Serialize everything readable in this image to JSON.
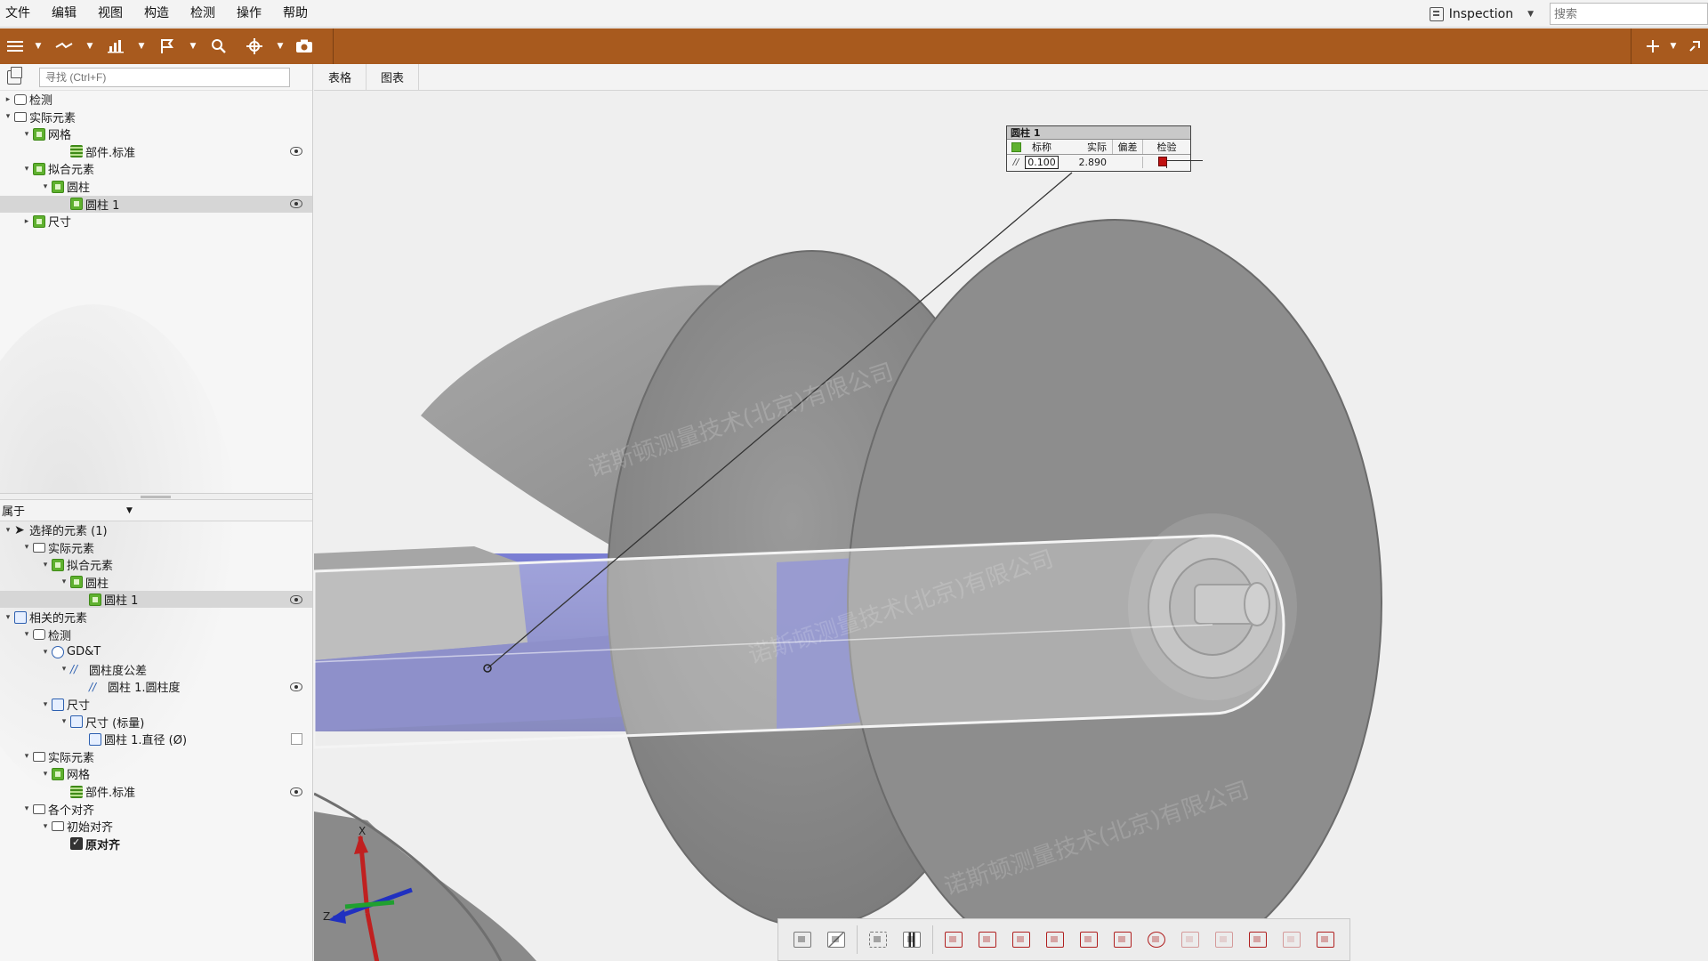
{
  "menu": [
    "文件",
    "编辑",
    "视图",
    "构造",
    "检测",
    "操作",
    "帮助"
  ],
  "workspace": {
    "name": "Inspection"
  },
  "search": {
    "placeholder": "搜索"
  },
  "find": {
    "placeholder": "寻找 (Ctrl+F)"
  },
  "tree_top": [
    {
      "label": "检测",
      "depth": 0,
      "twisty": "collapsed",
      "icon": "inspection-icon"
    },
    {
      "label": "实际元素",
      "depth": 0,
      "twisty": "expanded",
      "icon": "folder-icon"
    },
    {
      "label": "网格",
      "depth": 1,
      "twisty": "expanded",
      "icon": "mesh-icon"
    },
    {
      "label": "部件.标准",
      "depth": 3,
      "twisty": "none",
      "icon": "mesh-grid-icon",
      "eye": true
    },
    {
      "label": "拟合元素",
      "depth": 1,
      "twisty": "expanded",
      "icon": "fitted-elements-icon"
    },
    {
      "label": "圆柱",
      "depth": 2,
      "twisty": "expanded",
      "icon": "cylinder-group-icon"
    },
    {
      "label": "圆柱 1",
      "depth": 3,
      "twisty": "none",
      "icon": "cylinder-icon",
      "eye": true,
      "selected": true
    },
    {
      "label": "尺寸",
      "depth": 1,
      "twisty": "collapsed",
      "icon": "dimension-icon"
    }
  ],
  "properties": {
    "dropdown_label": "属于"
  },
  "tree_bottom": [
    {
      "label": "选择的元素 (1)",
      "depth": 0,
      "twisty": "expanded",
      "icon": "cursor-icon"
    },
    {
      "label": "实际元素",
      "depth": 1,
      "twisty": "expanded",
      "icon": "folder-icon"
    },
    {
      "label": "拟合元素",
      "depth": 2,
      "twisty": "expanded",
      "icon": "fitted-elements-icon"
    },
    {
      "label": "圆柱",
      "depth": 3,
      "twisty": "expanded",
      "icon": "cylinder-group-icon"
    },
    {
      "label": "圆柱 1",
      "depth": 4,
      "twisty": "none",
      "icon": "cylinder-icon",
      "eye": true,
      "selected": true
    },
    {
      "label": "相关的元素",
      "depth": 0,
      "twisty": "expanded",
      "icon": "related-icon"
    },
    {
      "label": "检测",
      "depth": 1,
      "twisty": "expanded",
      "icon": "inspection-icon"
    },
    {
      "label": "GD&T",
      "depth": 2,
      "twisty": "expanded",
      "icon": "gdt-target-icon"
    },
    {
      "label": "圆柱度公差",
      "depth": 3,
      "twisty": "expanded",
      "icon": "cylindricity-icon"
    },
    {
      "label": "圆柱 1.圆柱度",
      "depth": 4,
      "twisty": "none",
      "icon": "cylindricity-icon",
      "eye": true
    },
    {
      "label": "尺寸",
      "depth": 2,
      "twisty": "expanded",
      "icon": "dimension-blue-icon"
    },
    {
      "label": "尺寸 (标量)",
      "depth": 3,
      "twisty": "expanded",
      "icon": "dimension-scalar-icon"
    },
    {
      "label": "圆柱 1.直径 (Ø)",
      "depth": 4,
      "twisty": "none",
      "icon": "diameter-icon",
      "checkbox": true
    },
    {
      "label": "实际元素",
      "depth": 1,
      "twisty": "expanded",
      "icon": "folder-icon"
    },
    {
      "label": "网格",
      "depth": 2,
      "twisty": "expanded",
      "icon": "mesh-icon"
    },
    {
      "label": "部件.标准",
      "depth": 3,
      "twisty": "none",
      "icon": "mesh-grid-icon",
      "eye": true
    },
    {
      "label": "各个对齐",
      "depth": 1,
      "twisty": "expanded",
      "icon": "folder-icon"
    },
    {
      "label": "初始对齐",
      "depth": 2,
      "twisty": "expanded",
      "icon": "folder-icon"
    },
    {
      "label": "原对齐",
      "depth": 3,
      "twisty": "none",
      "icon": "alignment-icon",
      "bold": true
    }
  ],
  "tabs": [
    "表格",
    "图表"
  ],
  "annotation": {
    "title": "圆柱 1",
    "headers": [
      "标称",
      "实际",
      "偏差",
      "检验"
    ],
    "nominal": "0.100",
    "actual": "2.890",
    "deviation": ""
  },
  "axes": {
    "x_label": "X",
    "z_label": "Z"
  },
  "watermark": "诺斯顿测量技术(北京)有限公司",
  "colors": {
    "toolbar": "#a85a1e",
    "accent_red": "#b02020",
    "mesh_gray": "#8c8c8c",
    "deviation_blue": "#6a6fc4"
  }
}
